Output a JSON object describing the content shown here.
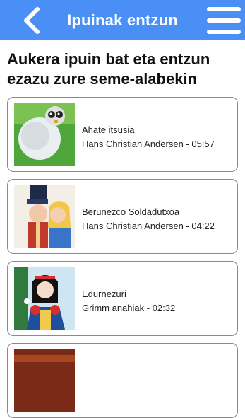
{
  "header": {
    "title": "Ipuinak entzun",
    "back_icon": "chevron-left-icon",
    "menu_icon": "hamburger-menu-icon",
    "bar_color": "#4a8ff6"
  },
  "main": {
    "heading": "Aukera ipuin bat eta entzun ezazu zure seme-alabekin"
  },
  "stories": [
    {
      "title": "Ahate itsusia",
      "subtitle": "Hans Christian Andersen - 05:57"
    },
    {
      "title": "Berunezco Soldadutxoa",
      "subtitle": "Hans Christian Andersen - 04:22"
    },
    {
      "title": "Edurnezuri",
      "subtitle": "Grimm anahiak - 02:32"
    },
    {
      "title": "",
      "subtitle": ""
    }
  ]
}
